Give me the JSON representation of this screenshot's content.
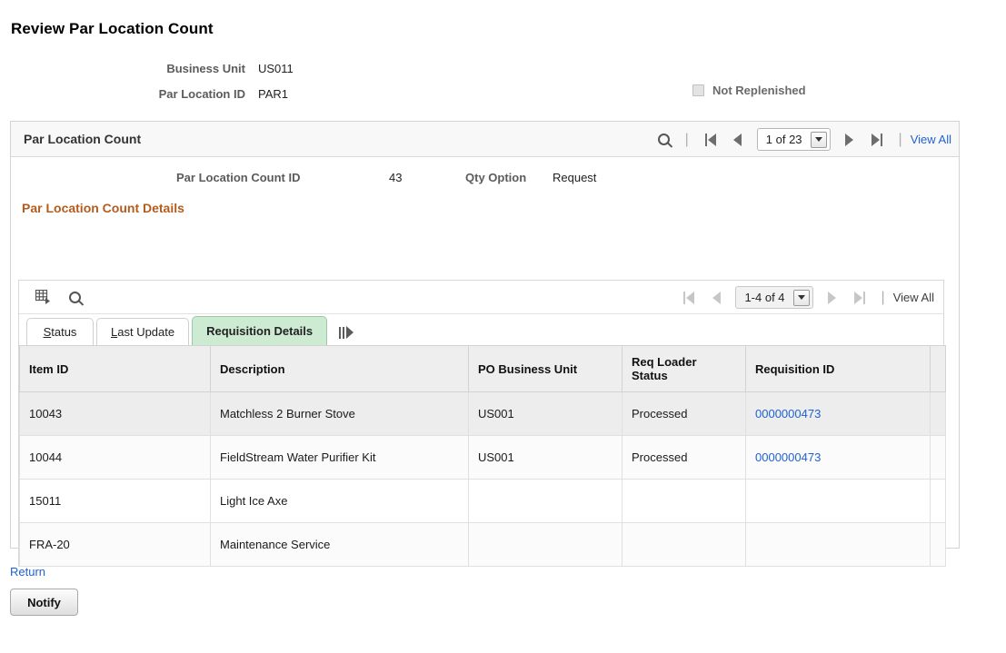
{
  "page": {
    "title": "Review Par Location Count"
  },
  "header_fields": {
    "business_unit_label": "Business Unit",
    "business_unit_value": "US011",
    "par_location_id_label": "Par Location ID",
    "par_location_id_value": "PAR1",
    "not_replenished_label": "Not Replenished",
    "not_replenished_checked": false
  },
  "panel": {
    "title": "Par Location Count",
    "nav": {
      "search_icon": "search-icon",
      "first_icon": "first-page-icon",
      "previous_icon": "previous-page-icon",
      "counter": "1 of 23",
      "next_icon": "next-page-icon",
      "last_icon": "last-page-icon",
      "view_all_label": "View All"
    },
    "count_id_label": "Par Location Count ID",
    "count_id_value": "43",
    "qty_option_label": "Qty Option",
    "qty_option_value": "Request"
  },
  "details": {
    "section_title": "Par Location Count Details",
    "toolbar": {
      "grid_export_icon": "grid-download-icon",
      "search_icon": "search-icon",
      "first_icon": "first-row-icon",
      "previous_icon": "previous-row-icon",
      "counter": "1-4 of 4",
      "next_icon": "next-row-icon",
      "last_icon": "last-row-icon",
      "view_all_label": "View All"
    },
    "tabs": [
      {
        "label": "Status",
        "accel": "S",
        "active": false
      },
      {
        "label": "Last Update",
        "accel": "L",
        "active": false
      },
      {
        "label": "Requisition Details",
        "accel": "",
        "active": true
      }
    ],
    "tab_next_icon": "show-next-tabs-icon",
    "columns": [
      "Item ID",
      "Description",
      "PO Business Unit",
      "Req Loader Status",
      "Requisition ID",
      ""
    ],
    "rows": [
      {
        "item_id": "10043",
        "description": "Matchless 2 Burner Stove",
        "po_business_unit": "US001",
        "req_loader_status": "Processed",
        "requisition_id": "0000000473",
        "requisition_is_link": true
      },
      {
        "item_id": "10044",
        "description": "FieldStream Water Purifier Kit",
        "po_business_unit": "US001",
        "req_loader_status": "Processed",
        "requisition_id": "0000000473",
        "requisition_is_link": true
      },
      {
        "item_id": "15011",
        "description": "Light Ice Axe",
        "po_business_unit": "",
        "req_loader_status": "",
        "requisition_id": "",
        "requisition_is_link": false
      },
      {
        "item_id": "FRA-20",
        "description": "Maintenance Service",
        "po_business_unit": "",
        "req_loader_status": "",
        "requisition_id": "",
        "requisition_is_link": false
      }
    ]
  },
  "footer": {
    "return_label": "Return",
    "notify_label": "Notify"
  },
  "colors": {
    "link": "#1f62d0",
    "section_title": "#b35c1e",
    "active_tab": "#cdebd3",
    "row_alt": "#ededed"
  }
}
